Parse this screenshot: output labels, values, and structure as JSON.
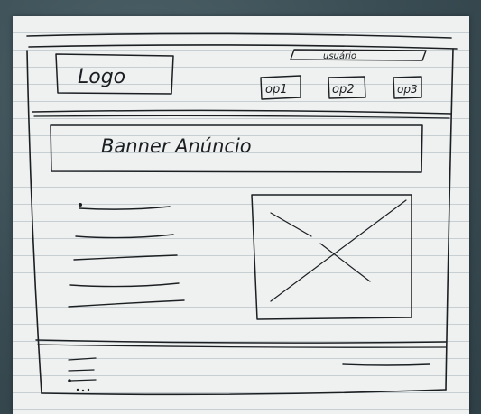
{
  "header": {
    "logo_label": "Logo",
    "user_label": "usuário",
    "nav": [
      {
        "label": "op1"
      },
      {
        "label": "op2"
      },
      {
        "label": "op3"
      }
    ]
  },
  "banner": {
    "label": "Banner Anúncio"
  },
  "colors": {
    "ink": "#1c1f22",
    "paper": "#eef1f0",
    "rule_lines": "#c7cfd3",
    "background": "#3b4e55"
  }
}
